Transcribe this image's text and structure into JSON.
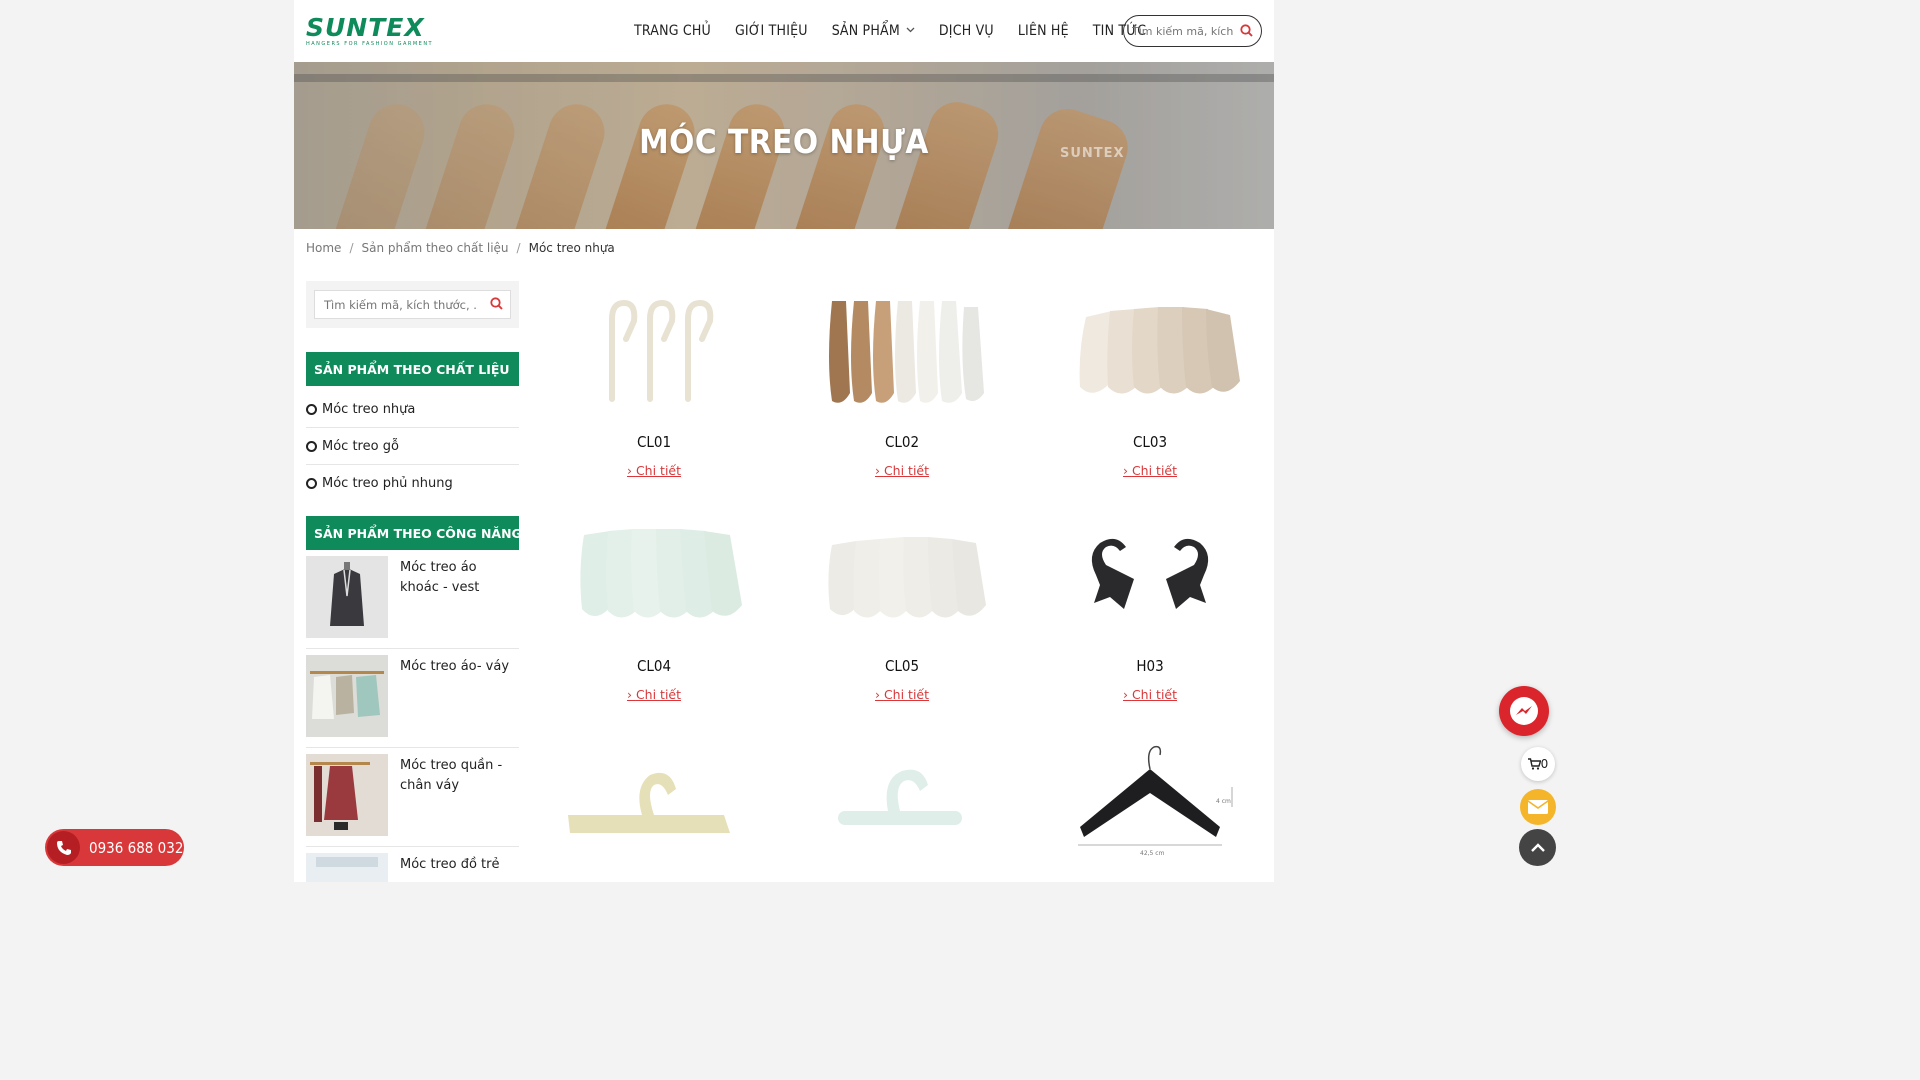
{
  "brand": {
    "name": "SUNTEX",
    "tagline": "HANGERS FOR FASHION GARMENT",
    "color": "#0e8a5b"
  },
  "nav": {
    "items": [
      {
        "label": "TRANG CHỦ"
      },
      {
        "label": "GIỚI THIỆU"
      },
      {
        "label": "SẢN PHẨM"
      },
      {
        "label": "DỊCH VỤ"
      },
      {
        "label": "LIÊN HỆ"
      },
      {
        "label": "TIN TỨC"
      }
    ],
    "search_placeholder": "Tìm kiếm mã, kích thước"
  },
  "banner": {
    "title": "MÓC TREO NHỰA",
    "watermark": "SUNTEX"
  },
  "breadcrumb": {
    "home": "Home",
    "parent": "Sản phẩm theo chất liệu",
    "current": "Móc treo nhựa"
  },
  "sidebar": {
    "search_placeholder": "Tìm kiếm mã, kích thước, ...",
    "material_heading": "SẢN PHẨM THEO CHẤT LIỆU",
    "materials": [
      "Móc treo nhựa",
      "Móc treo gỗ",
      "Móc treo phủ nhung"
    ],
    "function_heading": "SẢN PHẨM THEO CÔNG NĂNG",
    "functions": [
      "Móc treo áo khoác - vest",
      "Móc treo áo- váy",
      "Móc treo quần - chân váy",
      "Móc treo đồ trẻ"
    ]
  },
  "products": [
    {
      "code": "CL01",
      "detail": "Chi tiết"
    },
    {
      "code": "CL02",
      "detail": "Chi tiết"
    },
    {
      "code": "CL03",
      "detail": "Chi tiết"
    },
    {
      "code": "CL04",
      "detail": "Chi tiết"
    },
    {
      "code": "CL05",
      "detail": "Chi tiết"
    },
    {
      "code": "H03",
      "detail": "Chi tiết"
    }
  ],
  "product_image_labels": {
    "dimension_1": "4 cm",
    "dimension_2": "42,5 cm"
  },
  "contact": {
    "phone": "0936 688 032"
  },
  "cart": {
    "count": "0"
  },
  "colors": {
    "accent": "#0e8a5b",
    "red": "#d9383a"
  }
}
